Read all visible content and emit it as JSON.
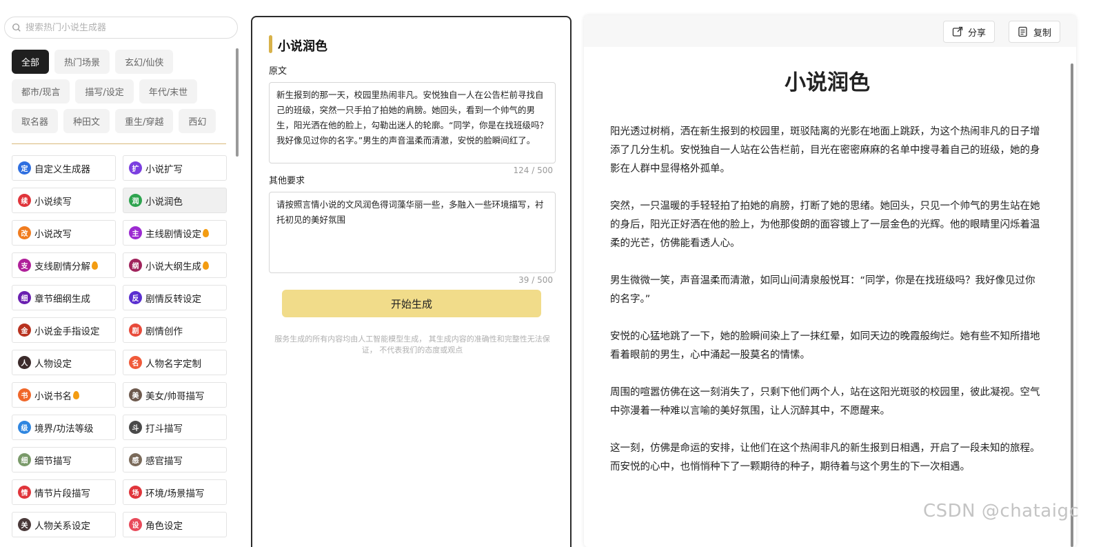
{
  "search": {
    "placeholder": "搜索热门小说生成器"
  },
  "filters": [
    "全部",
    "热门场景",
    "玄幻/仙侠",
    "都市/现言",
    "描写/设定",
    "年代/末世",
    "取名器",
    "种田文",
    "重生/穿越",
    "西幻"
  ],
  "active_filter": "全部",
  "tools": [
    {
      "label": "自定义生成器",
      "icon": "custom-generator-icon",
      "glyph": "定",
      "color": "#2f6fe0",
      "hot": false
    },
    {
      "label": "小说扩写",
      "icon": "expand-icon",
      "glyph": "扩",
      "color": "#7b3fe0",
      "hot": false
    },
    {
      "label": "小说续写",
      "icon": "continue-icon",
      "glyph": "续",
      "color": "#e0353b",
      "hot": false
    },
    {
      "label": "小说润色",
      "icon": "polish-icon",
      "glyph": "润",
      "color": "#2ea44f",
      "hot": false,
      "selected": true
    },
    {
      "label": "小说改写",
      "icon": "rewrite-icon",
      "glyph": "改",
      "color": "#f07c1f",
      "hot": false
    },
    {
      "label": "主线剧情设定",
      "icon": "main-plot-icon",
      "glyph": "主",
      "color": "#9c2ad1",
      "hot": true
    },
    {
      "label": "支线剧情分解",
      "icon": "sub-plot-icon",
      "glyph": "支",
      "color": "#b0209a",
      "hot": true
    },
    {
      "label": "小说大纲生成",
      "icon": "outline-icon",
      "glyph": "纲",
      "color": "#a0235c",
      "hot": true
    },
    {
      "label": "章节细纲生成",
      "icon": "chapter-outline-icon",
      "glyph": "细",
      "color": "#6a1fb0",
      "hot": false
    },
    {
      "label": "剧情反转设定",
      "icon": "plot-twist-icon",
      "glyph": "反",
      "color": "#5a2fd0",
      "hot": false
    },
    {
      "label": "小说金手指设定",
      "icon": "golden-finger-icon",
      "glyph": "金",
      "color": "#b8321f",
      "hot": false
    },
    {
      "label": "剧情创作",
      "icon": "plot-create-icon",
      "glyph": "剧",
      "color": "#e84a3a",
      "hot": false
    },
    {
      "label": "人物设定",
      "icon": "character-avatar-icon",
      "glyph": "人",
      "color": "#3b2a2a",
      "hot": false
    },
    {
      "label": "人物名字定制",
      "icon": "name-custom-icon",
      "glyph": "名",
      "color": "#f05a3a",
      "hot": false
    },
    {
      "label": "小说书名",
      "icon": "book-title-icon",
      "glyph": "书",
      "color": "#f0672a",
      "hot": true
    },
    {
      "label": "美女/帅哥描写",
      "icon": "portrait-avatar-icon",
      "glyph": "美",
      "color": "#6e5a4e",
      "hot": false
    },
    {
      "label": "境界/功法等级",
      "icon": "realm-level-icon",
      "glyph": "级",
      "color": "#2f86e0",
      "hot": false
    },
    {
      "label": "打斗描写",
      "icon": "fight-avatar-icon",
      "glyph": "斗",
      "color": "#4a4a4a",
      "hot": false
    },
    {
      "label": "细节描写",
      "icon": "magnifier-icon",
      "glyph": "细",
      "color": "#7a9a6a",
      "hot": false
    },
    {
      "label": "感官描写",
      "icon": "senses-avatar-icon",
      "glyph": "感",
      "color": "#7a6a5a",
      "hot": false
    },
    {
      "label": "情节片段描写",
      "icon": "scene-fragment-icon",
      "glyph": "情",
      "color": "#e0353b",
      "hot": false
    },
    {
      "label": "环境/场景描写",
      "icon": "environment-icon",
      "glyph": "场",
      "color": "#e0353b",
      "hot": false
    },
    {
      "label": "人物关系设定",
      "icon": "relationship-avatar-icon",
      "glyph": "关",
      "color": "#4a3a3a",
      "hot": false
    },
    {
      "label": "角色设定",
      "icon": "role-icon",
      "glyph": "设",
      "color": "#e84a5a",
      "hot": false
    }
  ],
  "form": {
    "title": "小说润色",
    "original_label": "原文",
    "original_text": "新生报到的那一天，校园里热闹非凡。安悦独自一人在公告栏前寻找自己的班级，突然一只手拍了拍她的肩膀。她回头，看到一个帅气的男生，阳光洒在他的脸上，勾勒出迷人的轮廓。“同学，你是在找班级吗？我好像见过你的名字。”男生的声音温柔而清澈，安悦的脸瞬间红了。",
    "original_count": "124 / 500",
    "other_label": "其他要求",
    "other_text": "请按照言情小说的文风润色得词藻华丽一些，多融入一些环境描写，衬托初见的美好氛围",
    "other_count": "39 / 500",
    "generate_label": "开始生成",
    "disclaimer": "服务生成的所有内容均由人工智能模型生成， 其生成内容的准确性和完整性无法保证， 不代表我们的态度或观点"
  },
  "output": {
    "share_label": "分享",
    "copy_label": "复制",
    "title": "小说润色",
    "paragraphs": [
      "阳光透过树梢，洒在新生报到的校园里，斑驳陆离的光影在地面上跳跃，为这个热闹非凡的日子增添了几分生机。安悦独自一人站在公告栏前，目光在密密麻麻的名单中搜寻着自己的班级，她的身影在人群中显得格外孤单。",
      "突然，一只温暖的手轻轻拍了拍她的肩膀，打断了她的思绪。她回头，只见一个帅气的男生站在她的身后，阳光正好洒在他的脸上，为他那俊朗的面容镀上了一层金色的光辉。他的眼睛里闪烁着温柔的光芒，仿佛能看透人心。",
      "男生微微一笑，声音温柔而清澈，如同山间清泉般悦耳：“同学，你是在找班级吗？我好像见过你的名字。”",
      "安悦的心猛地跳了一下，她的脸瞬间染上了一抹红晕，如同天边的晚霞般绚烂。她有些不知所措地看着眼前的男生，心中涌起一股莫名的情愫。",
      "周围的喧嚣仿佛在这一刻消失了，只剩下他们两个人，站在这阳光斑驳的校园里，彼此凝视。空气中弥漫着一种难以言喻的美好氛围，让人沉醉其中，不愿醒来。",
      "这一刻，仿佛是命运的安排，让他们在这个热闹非凡的新生报到日相遇，开启了一段未知的旅程。而安悦的心中，也悄悄种下了一颗期待的种子，期待着与这个男生的下一次相遇。"
    ]
  },
  "watermark": "CSDN @chataigc",
  "colors": {
    "accent": "#d8b24a",
    "button": "#f1dc8a",
    "active_filter": "#1f1f1f",
    "flame": "#f39c12"
  }
}
